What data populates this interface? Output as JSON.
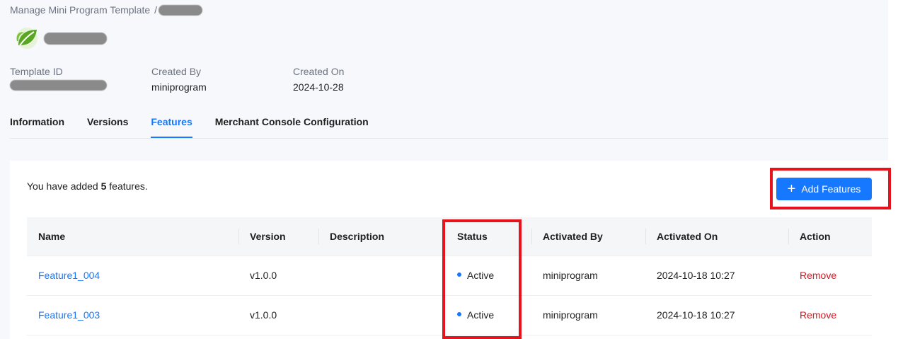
{
  "breadcrumb": {
    "root": "Manage Mini Program Template",
    "separator": "/"
  },
  "meta": {
    "template_id_label": "Template ID",
    "created_by_label": "Created By",
    "created_by_value": "miniprogram",
    "created_on_label": "Created On",
    "created_on_value": "2024-10-28"
  },
  "tabs": [
    {
      "label": "Information",
      "active": false
    },
    {
      "label": "Versions",
      "active": false
    },
    {
      "label": "Features",
      "active": true
    },
    {
      "label": "Merchant Console Configuration",
      "active": false
    }
  ],
  "summary": {
    "prefix": "You have added",
    "count": "5",
    "suffix": "features."
  },
  "add_button": {
    "label": "Add Features",
    "icon": "plus-icon"
  },
  "table": {
    "headers": [
      "Name",
      "Version",
      "Description",
      "Status",
      "Activated By",
      "Activated On",
      "Action"
    ],
    "rows": [
      {
        "name": "Feature1_004",
        "version": "v1.0.0",
        "description": "",
        "status": "Active",
        "activated_by": "miniprogram",
        "activated_on": "2024-10-18 10:27",
        "action": "Remove"
      },
      {
        "name": "Feature1_003",
        "version": "v1.0.0",
        "description": "",
        "status": "Active",
        "activated_by": "miniprogram",
        "activated_on": "2024-10-18 10:27",
        "action": "Remove"
      }
    ]
  },
  "colors": {
    "primary": "#1677ff",
    "danger": "#e6121c",
    "header_bg": "#f6f8fc"
  }
}
